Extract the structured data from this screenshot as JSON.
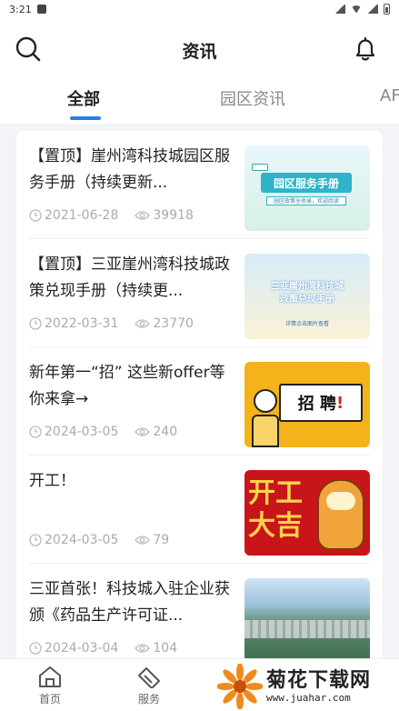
{
  "status_bar": {
    "time": "3:21"
  },
  "header": {
    "title": "资讯"
  },
  "tabs": [
    {
      "label": "全部",
      "active": true
    },
    {
      "label": "园区资讯",
      "active": false
    },
    {
      "label": "AF",
      "active": false
    }
  ],
  "articles": [
    {
      "title": "【置顶】崖州湾科技城园区服务手册（持续更新...",
      "date": "2021-06-28",
      "views": "39918",
      "thumb_text": "园区服务手册",
      "thumb_sub": "园区政策全收录，欢迎阅读"
    },
    {
      "title": "【置顶】三亚崖州湾科技城政策兑现手册（持续更...",
      "date": "2022-03-31",
      "views": "23770",
      "thumb_text_1": "三亚崖州湾科技城",
      "thumb_text_2": "政策兑现手册",
      "thumb_sub": "详情点击图片查看"
    },
    {
      "title": "新年第一“招” 这些新offer等你来拿→",
      "date": "2024-03-05",
      "views": "240",
      "thumb_text": "招 聘"
    },
    {
      "title": "开工！",
      "date": "2024-03-05",
      "views": "79",
      "thumb_text_1": "开工",
      "thumb_text_2": "大吉"
    },
    {
      "title": "三亚首张！科技城入驻企业获颁《药品生产许可证...",
      "date": "2024-03-04",
      "views": "104"
    }
  ],
  "bottom_nav": [
    {
      "label": "首页",
      "icon": "home-icon"
    },
    {
      "label": "服务",
      "icon": "service-icon"
    }
  ],
  "watermark": {
    "text": "菊花下载网",
    "url": "www.juahar.com"
  },
  "colors": {
    "accent": "#2b7de9",
    "background": "#f2f4f7"
  }
}
